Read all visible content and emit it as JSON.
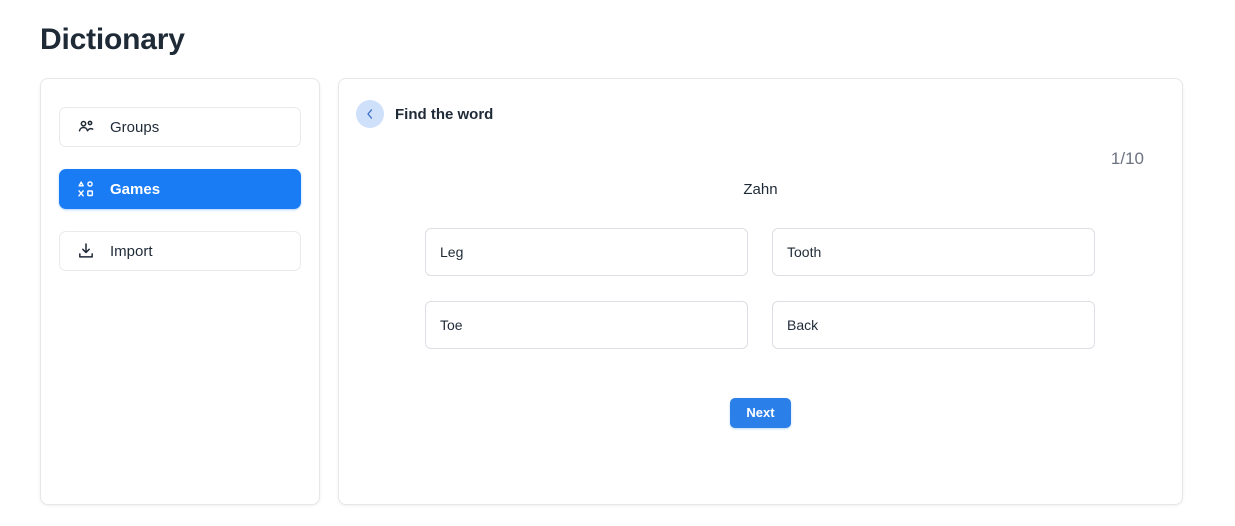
{
  "page": {
    "title": "Dictionary"
  },
  "sidebar": {
    "items": [
      {
        "label": "Groups",
        "icon": "users-icon",
        "active": false
      },
      {
        "label": "Games",
        "icon": "game-buttons-icon",
        "active": true
      },
      {
        "label": "Import",
        "icon": "download-icon",
        "active": false
      }
    ]
  },
  "game": {
    "back_icon": "chevron-left-icon",
    "title": "Find the word",
    "counter": "1/10",
    "prompt_word": "Zahn",
    "options": [
      {
        "label": "Leg"
      },
      {
        "label": "Tooth"
      },
      {
        "label": "Toe"
      },
      {
        "label": "Back"
      }
    ],
    "next_label": "Next"
  },
  "colors": {
    "accent_blue": "#1a7cf5",
    "button_blue": "#2b7fe8",
    "back_circle_blue": "#cfe0fb",
    "title_navy": "#1f2a37",
    "muted_gray": "#6b7280",
    "card_border": "#e5e7eb",
    "option_border": "#dcdfe4"
  }
}
